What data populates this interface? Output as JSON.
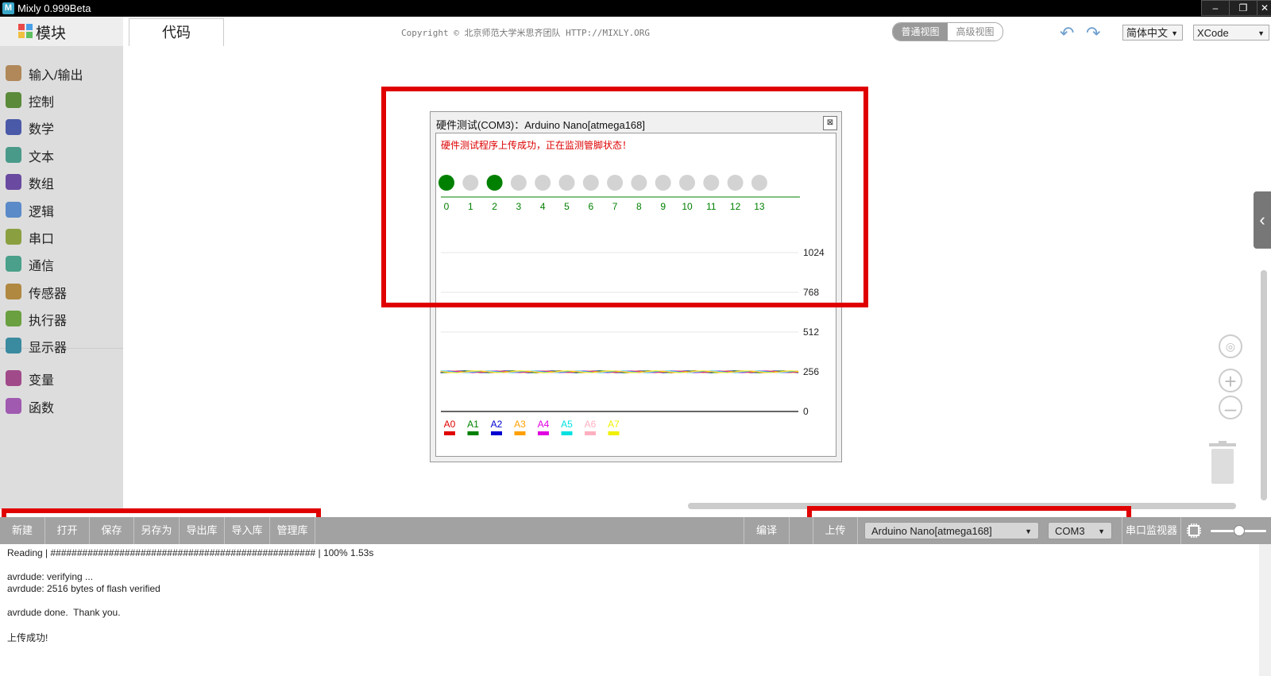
{
  "window": {
    "title": "Mixly 0.999Beta",
    "app_icon": "M"
  },
  "sidebar": {
    "header": "模块",
    "categories": [
      {
        "label": "输入/输出",
        "icon": "io-arrows-icon",
        "color": "#b0885a"
      },
      {
        "label": "控制",
        "icon": "gamepad-icon",
        "color": "#5b8a3a"
      },
      {
        "label": "数学",
        "icon": "sigma-icon",
        "color": "#4a5aa8"
      },
      {
        "label": "文本",
        "icon": "text-t-icon",
        "color": "#4a9a8a"
      },
      {
        "label": "数组",
        "icon": "blocks-icon",
        "color": "#6a4aa0"
      },
      {
        "label": "逻辑",
        "icon": "bulb-icon",
        "color": "#5a8ac8"
      },
      {
        "label": "串口",
        "icon": "probe-icon",
        "color": "#8aa040"
      },
      {
        "label": "通信",
        "icon": "satellite-icon",
        "color": "#4aa08a"
      },
      {
        "label": "传感器",
        "icon": "sensor-icon",
        "color": "#b08840"
      },
      {
        "label": "执行器",
        "icon": "actuator-icon",
        "color": "#6aa040"
      },
      {
        "label": "显示器",
        "icon": "monitor-icon",
        "color": "#3a8aa0"
      },
      {
        "label": "变量",
        "icon": "variable-icon",
        "color": "#a04a8a"
      },
      {
        "label": "函数",
        "icon": "function-icon",
        "color": "#a05ab0"
      }
    ]
  },
  "header": {
    "tab_code": "代码",
    "copyright": "Copyright © 北京师范大学米思齐团队 HTTP://MIXLY.ORG",
    "view_normal": "普通视图",
    "view_advanced": "高级视图",
    "language": "简体中文",
    "theme": "XCode"
  },
  "dialog": {
    "title": "硬件测试(COM3)：Arduino Nano[atmega168]",
    "close_label": "⊠",
    "status": "硬件测试程序上传成功，正在监测管脚状态！",
    "pins": [
      {
        "label": "0",
        "on": true
      },
      {
        "label": "1",
        "on": false
      },
      {
        "label": "2",
        "on": true
      },
      {
        "label": "3",
        "on": false
      },
      {
        "label": "4",
        "on": false
      },
      {
        "label": "5",
        "on": false
      },
      {
        "label": "6",
        "on": false
      },
      {
        "label": "7",
        "on": false
      },
      {
        "label": "8",
        "on": false
      },
      {
        "label": "9",
        "on": false
      },
      {
        "label": "10",
        "on": false
      },
      {
        "label": "11",
        "on": false
      },
      {
        "label": "12",
        "on": false
      },
      {
        "label": "13",
        "on": false
      }
    ],
    "pin_on_color": "#008000",
    "pin_off_color": "#d3d3d3"
  },
  "chart_data": {
    "type": "line",
    "ylim": [
      0,
      1024
    ],
    "yticks": [
      "1024",
      "768",
      "512",
      "256",
      "0"
    ],
    "series": [
      {
        "name": "A0",
        "color": "#e00000",
        "value": 256
      },
      {
        "name": "A1",
        "color": "#008000",
        "value": 256
      },
      {
        "name": "A2",
        "color": "#0000d0",
        "value": 256
      },
      {
        "name": "A3",
        "color": "#ffa000",
        "value": 256
      },
      {
        "name": "A4",
        "color": "#e000e0",
        "value": 256
      },
      {
        "name": "A5",
        "color": "#00e0e0",
        "value": 256
      },
      {
        "name": "A6",
        "color": "#ffb0c0",
        "value": 256
      },
      {
        "name": "A7",
        "color": "#f0f000",
        "value": 256
      }
    ]
  },
  "toolbar": {
    "new": "新建",
    "open": "打开",
    "save": "保存",
    "save_as": "另存为",
    "export_lib": "导出库",
    "import_lib": "导入库",
    "manage_lib": "管理库",
    "compile": "编译",
    "upload": "上传",
    "board": "Arduino Nano[atmega168]",
    "port": "COM3",
    "serial_monitor": "串口监视器"
  },
  "console": {
    "lines": [
      "Reading | ################################################## | 100% 1.53s",
      "",
      "avrdude: verifying ...",
      "avrdude: 2516 bytes of flash verified",
      "",
      "avrdude done.  Thank you.",
      "",
      "上传成功!"
    ]
  },
  "colors": {
    "highlight": "#e00000",
    "toolbar_bg": "#a2a2a2",
    "sidebar_bg": "#dddddd"
  }
}
